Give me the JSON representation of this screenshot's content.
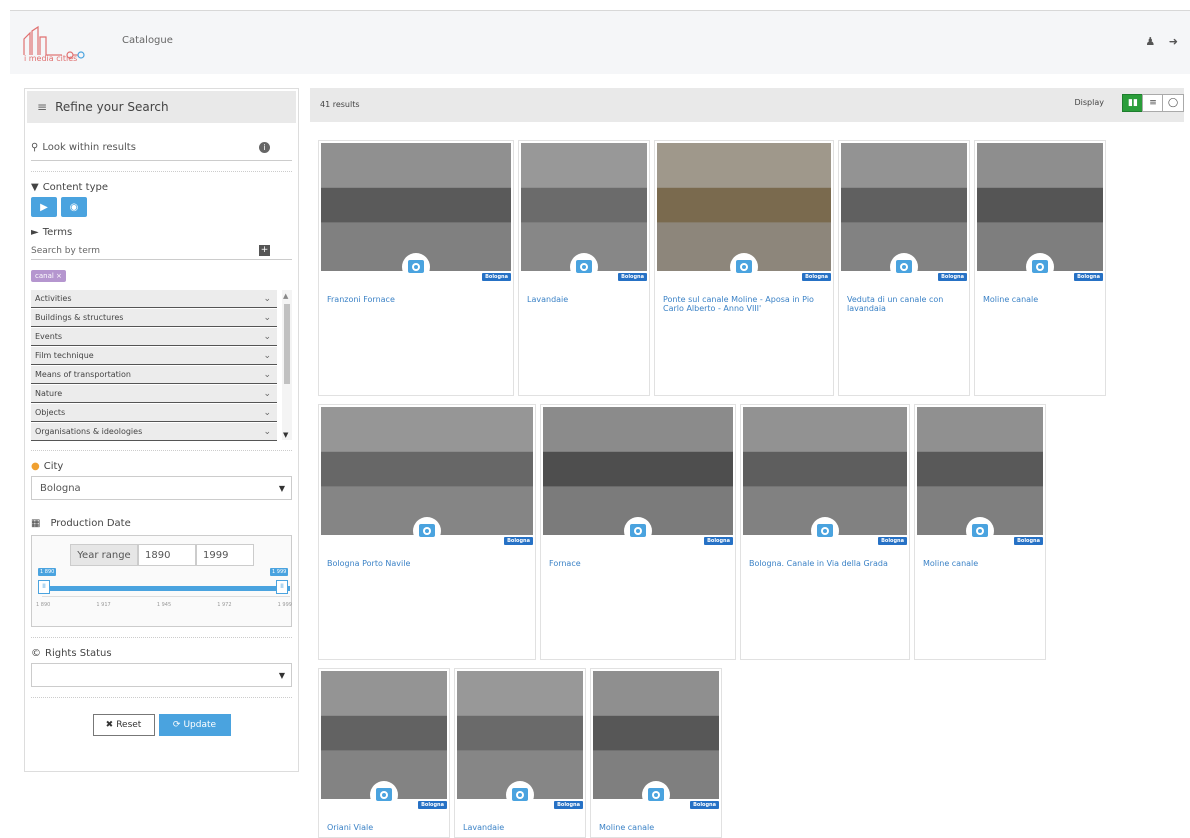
{
  "header": {
    "logo_text": "i media cities",
    "nav_catalogue": "Catalogue",
    "user_icon": "user-icon",
    "signout_icon": "sign-out-icon"
  },
  "sidebar": {
    "refine_title": "Refine your Search",
    "look_placeholder": "Look within results",
    "content_type_label": "Content type",
    "terms_label": "Terms",
    "term_search_placeholder": "Search by term",
    "active_chip": "canal",
    "term_categories": [
      "Activities",
      "Buildings & structures",
      "Events",
      "Film technique",
      "Means of transportation",
      "Nature",
      "Objects",
      "Organisations & ideologies"
    ],
    "city_label": "City",
    "city_value": "Bologna",
    "production_date_label": "Production Date",
    "year_range_label": "Year range",
    "year_from": "1890",
    "year_to": "1999",
    "slider_min_label": "1 890",
    "slider_max_label": "1 999",
    "slider_ticks": [
      "1 890",
      "1 917",
      "1 945",
      "1 972",
      "1 999"
    ],
    "rights_label": "Rights Status",
    "rights_value": "",
    "reset_label": "Reset",
    "update_label": "Update"
  },
  "results": {
    "count_text": "41 results",
    "display_label": "Display",
    "display_modes": [
      "grid",
      "list",
      "map"
    ],
    "active_mode": "grid"
  },
  "items": [
    {
      "title": "Franzoni Fornace",
      "tag": "Bologna"
    },
    {
      "title": "Lavandaie",
      "tag": "Bologna"
    },
    {
      "title": "Ponte sul canale Moline - Aposa in Pio Carlo Alberto - Anno VIII'",
      "tag": "Bologna"
    },
    {
      "title": "Veduta di un canale con lavandaia",
      "tag": "Bologna"
    },
    {
      "title": "Moline canale",
      "tag": "Bologna"
    },
    {
      "title": "Bologna Porto Navile",
      "tag": "Bologna"
    },
    {
      "title": "Fornace",
      "tag": "Bologna"
    },
    {
      "title": "Bologna. Canale in Via della Grada",
      "tag": "Bologna"
    },
    {
      "title": "Moline canale",
      "tag": "Bologna"
    },
    {
      "title": "Oriani Viale",
      "tag": "Bologna"
    },
    {
      "title": "Lavandaie",
      "tag": "Bologna"
    },
    {
      "title": "Moline canale",
      "tag": "Bologna"
    }
  ],
  "colors": {
    "accent_blue": "#4aa3df",
    "tag_blue": "#2671c5",
    "title_blue": "#3b82c6",
    "active_green": "#2a9d3a",
    "chip_purple": "#b596cf"
  }
}
